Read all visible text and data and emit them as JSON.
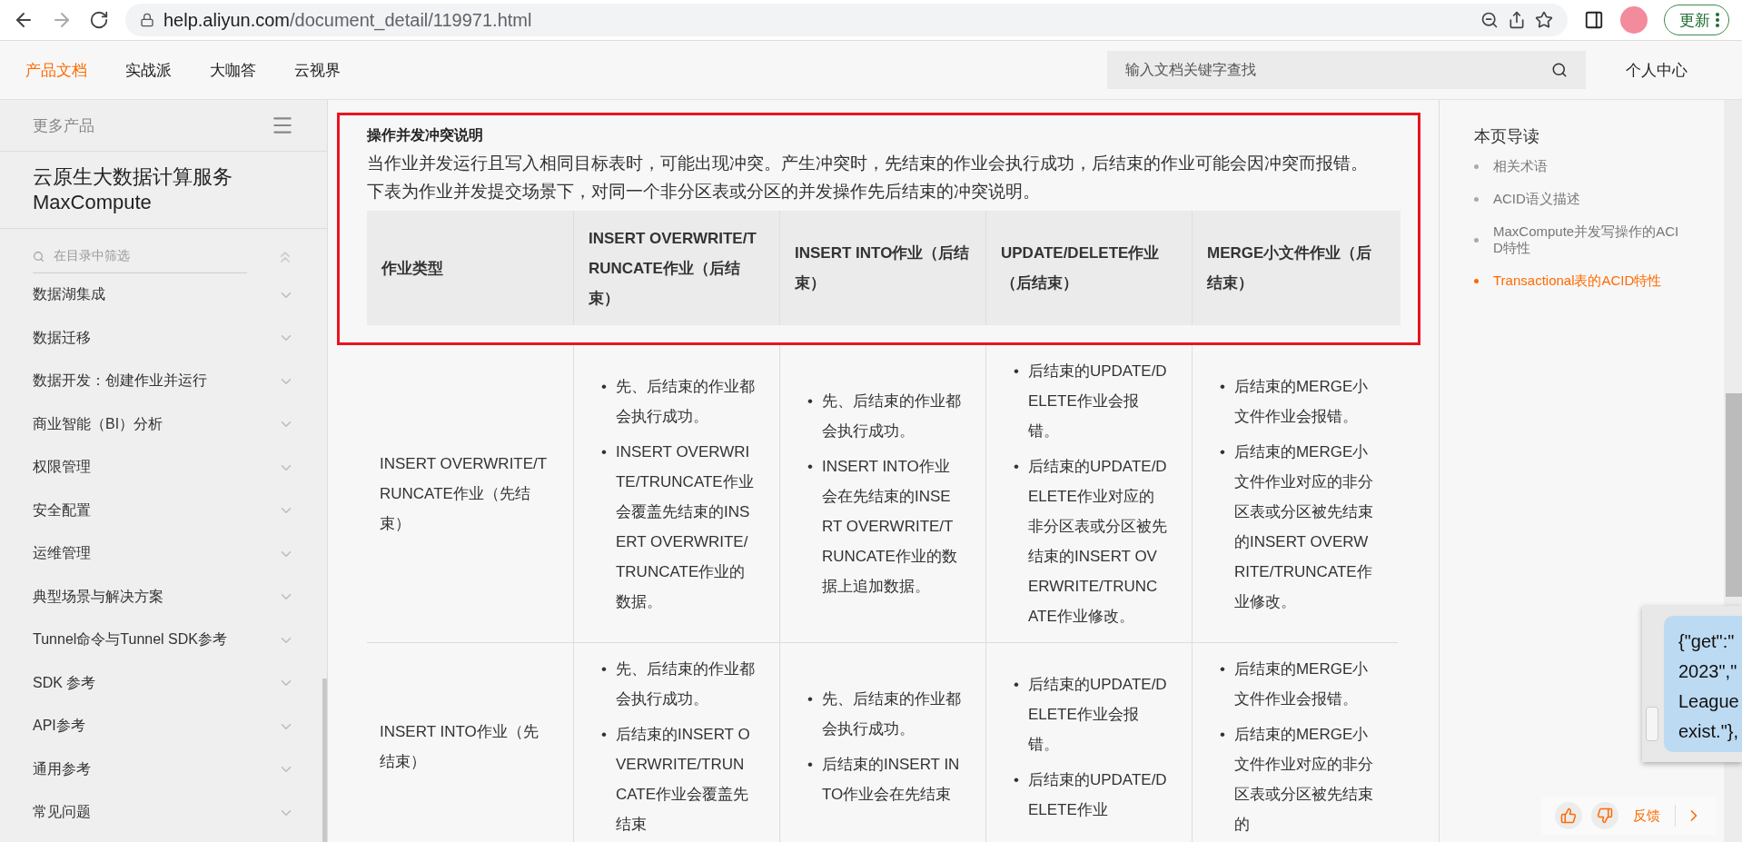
{
  "browser": {
    "url_host": "help.aliyun.com",
    "url_path": "/document_detail/119971.html",
    "update_button": "更新"
  },
  "nav": {
    "tabs": [
      {
        "label": "产品文档",
        "selected": true
      },
      {
        "label": "实战派",
        "selected": false
      },
      {
        "label": "大咖答",
        "selected": false
      },
      {
        "label": "云视界",
        "selected": false
      }
    ],
    "search": {
      "placeholder": "输入文档关键字查找"
    },
    "account": "个人中心"
  },
  "sidebar": {
    "header": "更多产品",
    "product_title": "云原生大数据计算服务",
    "product_name": "MaxCompute",
    "filter": {
      "placeholder": "在目录中筛选"
    },
    "items": [
      {
        "label": "数据湖集成",
        "expanded": false
      },
      {
        "label": "数据迁移",
        "expanded": false
      },
      {
        "label": "数据开发：创建作业并运行",
        "expanded": false
      },
      {
        "label": "商业智能（BI）分析",
        "expanded": false
      },
      {
        "label": "权限管理",
        "expanded": false
      },
      {
        "label": "安全配置",
        "expanded": false
      },
      {
        "label": "运维管理",
        "expanded": false
      },
      {
        "label": "典型场景与解决方案",
        "expanded": false
      },
      {
        "label": "Tunnel命令与Tunnel SDK参考",
        "expanded": false
      },
      {
        "label": "SDK 参考",
        "expanded": false
      },
      {
        "label": "API参考",
        "expanded": false
      },
      {
        "label": "通用参考",
        "expanded": false
      },
      {
        "label": "常见问题",
        "expanded": false
      }
    ]
  },
  "section": {
    "title": "操作并发冲突说明",
    "paragraphs": [
      "当作业并发运行且写入相同目标表时，可能出现冲突。产生冲突时，先结束的作业会执行成功，后结束的作业可能会因冲突而报错。",
      "下表为作业并发提交场景下，对同一个非分区表或分区的并发操作先后结束的冲突说明。"
    ],
    "table": {
      "bullet": "•",
      "columns": [
        "作业类型",
        "INSERT OVERWRITE/TRUNCATE作业（后结束）",
        "INSERT INTO作业（后结束）",
        "UPDATE/DELETE作业（后结束）",
        "MERGE小文件作业（后结束）"
      ],
      "rows": [
        {
          "cells": [
            {
              "kind": "text",
              "text": "INSERT OVERWRITE/TRUNCATE作业（先结束）"
            },
            {
              "kind": "bullets",
              "items": [
                "先、后结束的作业都会执行成功。",
                "INSERT OVERWRITE/TRUNCATE作业会覆盖先结束的INSERT OVERWRITE/TRUNCATE作业的数据。"
              ]
            },
            {
              "kind": "bullets",
              "items": [
                "先、后结束的作业都会执行成功。",
                "INSERT INTO作业会在先结束的INSERT OVERWRITE/TRUNCATE作业的数据上追加数据。"
              ]
            },
            {
              "kind": "bullets",
              "items": [
                "后结束的UPDATE/DELETE作业会报错。",
                "后结束的UPDATE/DELETE作业对应的非分区表或分区被先结束的INSERT OVERWRITE/TRUNCATE作业修改。"
              ]
            },
            {
              "kind": "bullets",
              "items": [
                "后结束的MERGE小文件作业会报错。",
                "后结束的MERGE小文件作业对应的非分区表或分区被先结束的INSERT OVERWRITE/TRUNCATE作业修改。"
              ]
            }
          ]
        },
        {
          "cells": [
            {
              "kind": "text",
              "text": "INSERT INTO作业（先结束）"
            },
            {
              "kind": "bullets",
              "items": [
                "先、后结束的作业都会执行成功。",
                "后结束的INSERT OVERWRITE/TRUNCATE作业会覆盖先结束"
              ]
            },
            {
              "kind": "bullets",
              "items": [
                "先、后结束的作业都会执行成功。",
                "后结束的INSERT INTO作业会在先结束"
              ]
            },
            {
              "kind": "bullets",
              "items": [
                "后结束的UPDATE/DELETE作业会报错。",
                "后结束的UPDATE/DELETE作业"
              ]
            },
            {
              "kind": "bullets",
              "items": [
                "后结束的MERGE小文件作业会报错。",
                "后结束的MERGE小文件作业对应的非分区表或分区被先结束的"
              ]
            }
          ]
        }
      ]
    }
  },
  "toc": {
    "title": "本页导读",
    "items": [
      {
        "label": "相关术语",
        "selected": false
      },
      {
        "label": "ACID语义描述",
        "selected": false
      },
      {
        "label": "MaxCompute并发写操作的ACID特性",
        "selected": false
      },
      {
        "label": "Transactional表的ACID特性",
        "selected": true
      }
    ]
  },
  "popup": {
    "lines": [
      "{\"get\":\"",
      "2023\",\"",
      "League",
      "exist.\"},"
    ]
  },
  "feedback": {
    "label": "反馈"
  }
}
